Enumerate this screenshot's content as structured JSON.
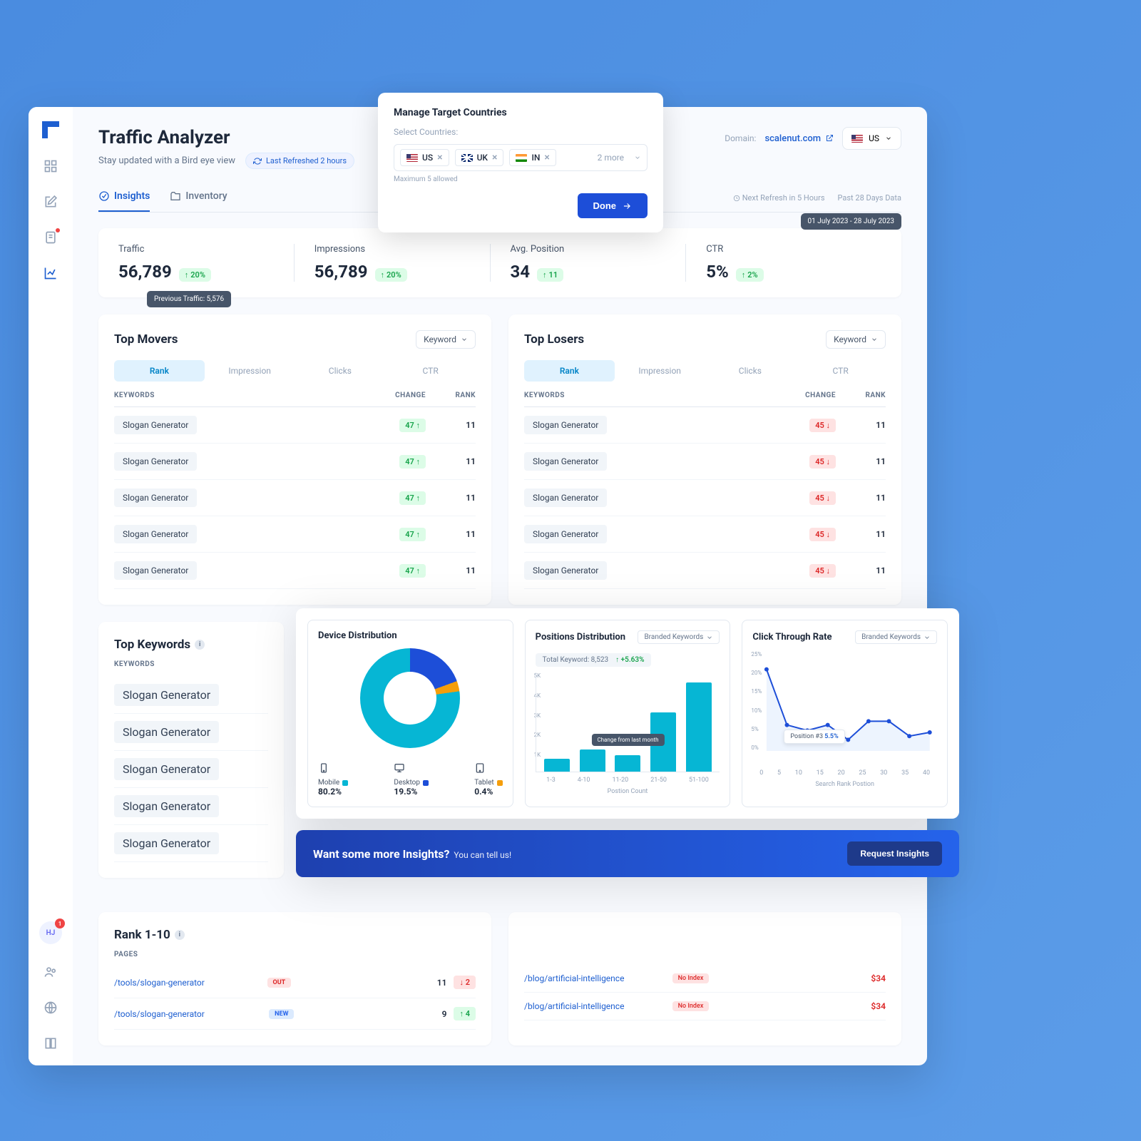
{
  "header": {
    "title": "Traffic Analyzer",
    "subtitle": "Stay updated with a Bird eye view",
    "refresh_label": "Last Refreshed 2 hours",
    "domain_label": "Domain:",
    "domain_value": "scalenut.com",
    "country_selected": "US",
    "next_refresh": "Next Refresh in 5 Hours",
    "past_data": "Past 28 Days Data",
    "date_range": "01 July 2023 - 28 July 2023"
  },
  "tabs": {
    "insights": "Insights",
    "inventory": "Inventory"
  },
  "metrics": {
    "traffic": {
      "label": "Traffic",
      "value": "56,789",
      "delta": "20%",
      "tooltip": "Previous Traffic:  5,576"
    },
    "impressions": {
      "label": "Impressions",
      "value": "56,789",
      "delta": "20%"
    },
    "avg_position": {
      "label": "Avg. Position",
      "value": "34",
      "delta": "11"
    },
    "ctr": {
      "label": "CTR",
      "value": "5%",
      "delta": "2%"
    }
  },
  "movers": {
    "title": "Top Movers",
    "dropdown": "Keyword",
    "seg_tabs": [
      "Rank",
      "Impression",
      "Clicks",
      "CTR"
    ],
    "cols": {
      "kw": "KEYWORDS",
      "change": "CHANGE",
      "rank": "RANK"
    },
    "rows": [
      {
        "kw": "Slogan Generator",
        "change": "47",
        "rank": "11"
      },
      {
        "kw": "Slogan Generator",
        "change": "47",
        "rank": "11"
      },
      {
        "kw": "Slogan Generator",
        "change": "47",
        "rank": "11"
      },
      {
        "kw": "Slogan Generator",
        "change": "47",
        "rank": "11"
      },
      {
        "kw": "Slogan Generator",
        "change": "47",
        "rank": "11"
      }
    ]
  },
  "losers": {
    "title": "Top Losers",
    "dropdown": "Keyword",
    "seg_tabs": [
      "Rank",
      "Impression",
      "Clicks",
      "CTR"
    ],
    "cols": {
      "kw": "KEYWORDS",
      "change": "CHANGE",
      "rank": "RANK"
    },
    "rows": [
      {
        "kw": "Slogan Generator",
        "change": "45",
        "rank": "11"
      },
      {
        "kw": "Slogan Generator",
        "change": "45",
        "rank": "11"
      },
      {
        "kw": "Slogan Generator",
        "change": "45",
        "rank": "11"
      },
      {
        "kw": "Slogan Generator",
        "change": "45",
        "rank": "11"
      },
      {
        "kw": "Slogan Generator",
        "change": "45",
        "rank": "11"
      }
    ]
  },
  "top_keywords": {
    "title": "Top Keywords",
    "label": "KEYWORDS",
    "items": [
      "Slogan Generator",
      "Slogan Generator",
      "Slogan Generator",
      "Slogan Generator",
      "Slogan Generator"
    ]
  },
  "rank_panel": {
    "title": "Rank 1-10",
    "label": "PAGES",
    "left_rows": [
      {
        "url": "/tools/slogan-generator",
        "badge": "OUT",
        "count": "11",
        "delta": "2"
      },
      {
        "url": "/tools/slogan-generator",
        "badge": "NEW",
        "count": "9",
        "delta": "4"
      }
    ],
    "right_rows": [
      {
        "url": "/blog/artificial-intelligence",
        "badge": "No Index",
        "price": "$34"
      },
      {
        "url": "/blog/artificial-intelligence",
        "badge": "No Index",
        "price": "$34"
      }
    ]
  },
  "device": {
    "title": "Device Distribution",
    "items": [
      {
        "name": "Mobile",
        "pct": "80.2%",
        "color": "#06b6d4"
      },
      {
        "name": "Desktop",
        "pct": "19.5%",
        "color": "#1d4ed8"
      },
      {
        "name": "Tablet",
        "pct": "0.4%",
        "color": "#f59e0b"
      }
    ]
  },
  "positions": {
    "title": "Positions Distribution",
    "dropdown": "Branded Keywords",
    "total_label": "Total Keyword: 8,523",
    "total_delta": "+5.63%",
    "axis": "Postion Count",
    "tooltip": "Change from last month"
  },
  "ctr_chart": {
    "title": "Click Through Rate",
    "dropdown": "Branded Keywords",
    "axis": "Search Rank Postion",
    "tooltip_label": "Position #3",
    "tooltip_value": "5.5%"
  },
  "cta": {
    "text": "Want some more Insights?",
    "sub": "You can tell us!",
    "button": "Request Insights"
  },
  "modal": {
    "title": "Manage Target Countries",
    "select_label": "Select Countries:",
    "chips": [
      {
        "code": "US"
      },
      {
        "code": "UK"
      },
      {
        "code": "IN"
      }
    ],
    "more": "2 more",
    "hint": "Maximum 5 allowed",
    "done": "Done"
  },
  "avatar": {
    "initials": "HJ",
    "notif": "1"
  },
  "chart_data": [
    {
      "type": "pie",
      "title": "Device Distribution",
      "categories": [
        "Mobile",
        "Desktop",
        "Tablet"
      ],
      "values": [
        80.2,
        19.5,
        0.4
      ],
      "colors": [
        "#06b6d4",
        "#1d4ed8",
        "#f59e0b"
      ]
    },
    {
      "type": "bar",
      "title": "Positions Distribution",
      "categories": [
        "1-3",
        "4-10",
        "11-20",
        "21-50",
        "51-100"
      ],
      "values": [
        700,
        1200,
        900,
        3200,
        4800
      ],
      "xlabel": "Postion Count",
      "ylabel": "",
      "ylim": [
        0,
        5000
      ]
    },
    {
      "type": "line",
      "title": "Click Through Rate",
      "x": [
        0,
        5,
        10,
        15,
        20,
        25,
        30,
        35,
        40
      ],
      "values": [
        22,
        7,
        5.5,
        7,
        3,
        8,
        8,
        4,
        5
      ],
      "xlabel": "Search Rank Postion",
      "ylabel": "%",
      "ylim": [
        0,
        25
      ]
    }
  ]
}
